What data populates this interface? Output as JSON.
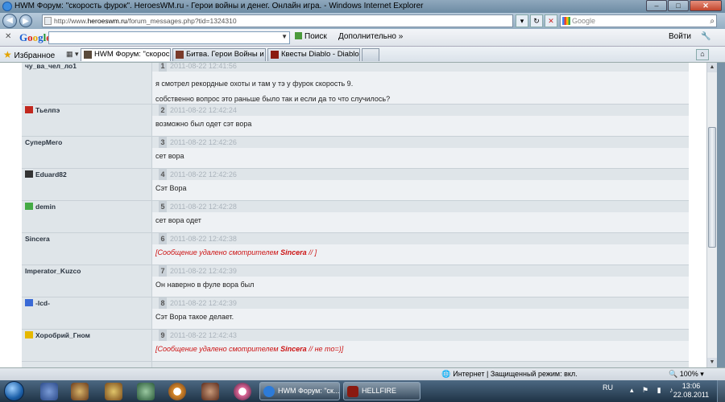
{
  "window": {
    "title": "HWM Форум: \"скорость фурок\". HeroesWM.ru - Герои войны и денег. Онлайн игра. - Windows Internet Explorer",
    "minimize": "–",
    "maximize": "□",
    "close": "✕"
  },
  "address": {
    "prefix": "http://www.",
    "host": "heroeswm.ru",
    "path": "/forum_messages.php?tid=1324310",
    "search_placeholder": "Google"
  },
  "google_toolbar": {
    "search_label": "Поиск",
    "more_label": "Дополнительно »",
    "login_label": "Войти"
  },
  "favorites": {
    "label": "Избранное",
    "tabs": [
      {
        "title": "HWM Форум: \"скорос...",
        "active": true
      },
      {
        "title": "Битва. Герои Войны и Де...",
        "active": false
      },
      {
        "title": "Квесты Diablo - Diablo Ar...",
        "active": false
      }
    ]
  },
  "forum": {
    "messages": [
      {
        "author": "чу_ва_чел_ло1",
        "num": "1",
        "date": "2011-08-22 12:41:56",
        "text": "я смотрел рекордные охоты и там у тэ у фурок скорость 9.",
        "text2": "собственно вопрос это раньше было так и если да то что случилось?",
        "deleted": false
      },
      {
        "author": "Тьелпэ",
        "num": "2",
        "date": "2011-08-22 12:42:24",
        "text": "возможно был одет сэт вора",
        "deleted": false
      },
      {
        "author": "СуперМего",
        "num": "3",
        "date": "2011-08-22 12:42:26",
        "text": "сет вора",
        "deleted": false
      },
      {
        "author": "Eduard82",
        "num": "4",
        "date": "2011-08-22 12:42:26",
        "text": "Сэт Вора",
        "deleted": false
      },
      {
        "author": "demin",
        "num": "5",
        "date": "2011-08-22 12:42:28",
        "text": "сет вора одет",
        "deleted": false
      },
      {
        "author": "Sincera",
        "num": "6",
        "date": "2011-08-22 12:42:38",
        "del_pre": "[Сообщение удалено смотрителем ",
        "del_name": "Sincera",
        "del_post": " // ]",
        "deleted": true
      },
      {
        "author": "Imperator_Kuzco",
        "num": "7",
        "date": "2011-08-22 12:42:39",
        "text": "Он наверно в фуле вора был",
        "deleted": false
      },
      {
        "author": "-lcd-",
        "num": "8",
        "date": "2011-08-22 12:42:39",
        "text": "Сэт Вора такое делает.",
        "deleted": false
      },
      {
        "author": "Хоробрий_Гном",
        "num": "9",
        "date": "2011-08-22 12:42:43",
        "del_pre": "[Сообщение удалено смотрителем ",
        "del_name": "Sincera",
        "del_post": " // не то=)]",
        "deleted": true
      }
    ]
  },
  "statusbar": {
    "zone": "Интернет | Защищенный режим: вкл.",
    "zoom": "100%"
  },
  "taskbar": {
    "tasks": [
      {
        "title": "HWM Форум: \"ск...",
        "icon_color": "#2d7bd8"
      },
      {
        "title": "HELLFIRE",
        "icon_color": "#8b1a10"
      }
    ],
    "lang": "RU",
    "time": "13:06",
    "date": "22.08.2011"
  },
  "colors": {
    "author_bg": "#dfe5e9",
    "body_bg": "#eef1f4",
    "deleted_text": "#cc1111"
  }
}
